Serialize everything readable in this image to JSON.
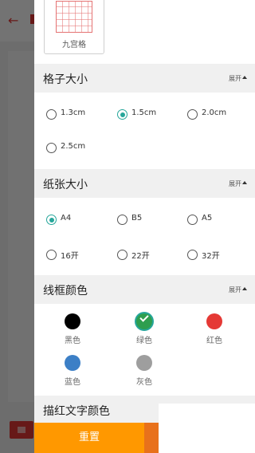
{
  "colors": {
    "accent": "#26a69a",
    "reset_button": "#ff9800",
    "header_bg": "#f0f0f0",
    "brand_red": "#e53935"
  },
  "template": {
    "label": "九宫格",
    "icon": "nine-grid-icon"
  },
  "sections": {
    "grid_size": {
      "title": "格子大小",
      "expand_label": "展开",
      "options": [
        "1.3cm",
        "1.5cm",
        "2.0cm",
        "2.5cm"
      ],
      "selected": "1.5cm"
    },
    "paper_size": {
      "title": "纸张大小",
      "expand_label": "展开",
      "options": [
        "A4",
        "B5",
        "A5",
        "16开",
        "22开",
        "32开"
      ],
      "selected": "A4"
    },
    "line_color": {
      "title": "线框颜色",
      "expand_label": "展开",
      "options": [
        {
          "label": "黑色",
          "color": "#000000"
        },
        {
          "label": "绿色",
          "color": "#2e9e4f"
        },
        {
          "label": "红色",
          "color": "#e53935"
        },
        {
          "label": "蓝色",
          "color": "#3c7fc6"
        },
        {
          "label": "灰色",
          "color": "#9e9e9e"
        }
      ],
      "selected": "绿色"
    },
    "trace_color": {
      "title": "描红文字颜色"
    }
  },
  "actions": {
    "reset_label": "重置"
  }
}
